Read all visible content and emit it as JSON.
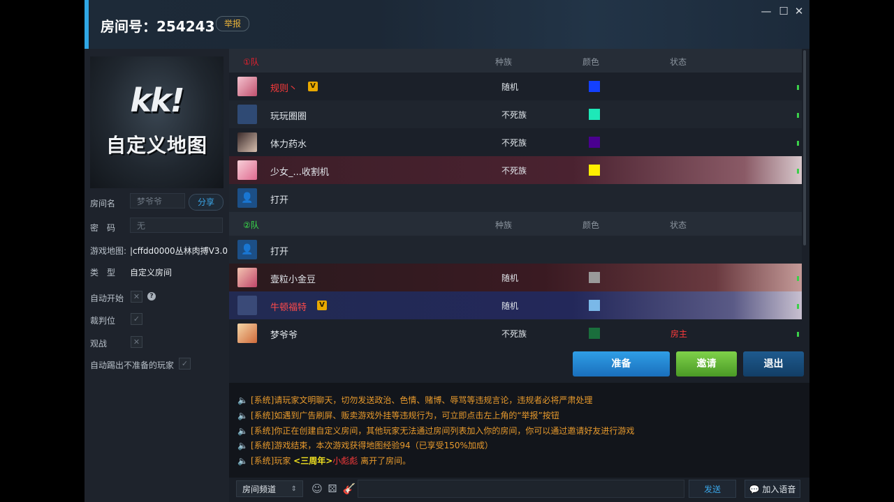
{
  "header": {
    "room_title": "房间号：254243",
    "report_label": "举报"
  },
  "window_controls": {
    "minimize": "—",
    "maximize": "☐",
    "close": "✕"
  },
  "left_panel": {
    "map_banner_title": "kk!",
    "map_banner_subtitle": "自定义地图",
    "room_name_label": "房间名",
    "room_name_placeholder": "梦爷爷",
    "share_label": "分享",
    "password_label": "密　码",
    "password_placeholder": "无",
    "game_map_label": "游戏地图:",
    "game_map_value": "|cffdd0000丛林肉搏V3.0",
    "type_label": "类　型",
    "type_value": "自定义房间",
    "auto_start_label": "自动开始",
    "referee_label": "裁判位",
    "spectate_label": "观战",
    "auto_kick_label": "自动踢出不准备的玩家"
  },
  "team1": {
    "label": "①队",
    "label_color": "#e8202e",
    "col_race": "种族",
    "col_color": "颜色",
    "col_status": "状态",
    "players": [
      {
        "name": "规则丶",
        "vip": "V",
        "race": "随机",
        "color": "#1340ff",
        "name_color": "#ff3b3b"
      },
      {
        "name": "玩玩圈圈",
        "race": "不死族",
        "color": "#1ee8b8"
      },
      {
        "name": "体力药水",
        "race": "不死族",
        "color": "#4a0090"
      },
      {
        "name": "少女_...收割机",
        "race": "不死族",
        "color": "#ffee00"
      },
      {
        "name": "打开"
      }
    ]
  },
  "team2": {
    "label": "②队",
    "label_color": "#39e04a",
    "col_race": "种族",
    "col_color": "颜色",
    "col_status": "状态",
    "players": [
      {
        "name": "打开"
      },
      {
        "name": "壹粒小金豆",
        "race": "随机",
        "color": "#9a9a9a"
      },
      {
        "name": "牛顿福特",
        "vip": "V",
        "race": "随机",
        "color": "#7ab8e8",
        "name_color": "#ff4a4a"
      },
      {
        "name": "梦爷爷",
        "race": "不死族",
        "color": "#1a6e3c",
        "status": "房主"
      }
    ]
  },
  "actions": {
    "ready": "准备",
    "invite": "邀请",
    "exit": "退出"
  },
  "chat_messages": [
    "[系统]请玩家文明聊天，切勿发送政治、色情、赌博、辱骂等违规言论，违规者必将严肃处理",
    "[系统]如遇到广告刷屏、贩卖游戏外挂等违规行为，可立即点击左上角的“举报”按钮",
    "[系统]你正在创建自定义房间，其他玩家无法通过房间列表加入你的房间，你可以通过邀请好友进行游戏",
    "[系统]游戏结束，本次游戏获得地图经验94（已享受150%加成）"
  ],
  "last_message": {
    "prefix": "[系统]玩家",
    "tag": "<三周年>",
    "player": "小彪彪",
    "suffix": "离开了房间。"
  },
  "chat_bar": {
    "channel": "房间频道",
    "send": "发送",
    "voice": "加入语音"
  },
  "icons": {
    "speaker": "🔈",
    "emoji": "☺",
    "dice": "⚄",
    "gift": "🎸",
    "voice": "💬",
    "person": "👤",
    "help": "?",
    "check": "✓",
    "cross": "✕",
    "updown": "⇕"
  }
}
